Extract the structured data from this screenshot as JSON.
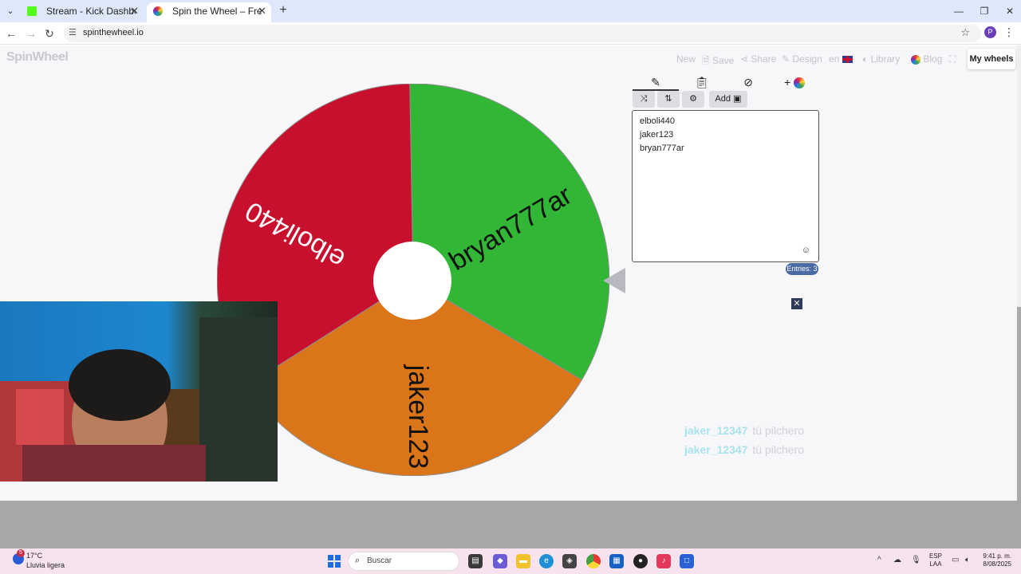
{
  "browser": {
    "tabs": [
      {
        "title": "Stream - Kick Dashboard",
        "active": false
      },
      {
        "title": "Spin the Wheel – Free and easy",
        "active": true
      }
    ],
    "url": "spinthewheel.io",
    "profile_initial": "P"
  },
  "app": {
    "logo": "SpinWheel",
    "nav": {
      "new": "New",
      "save": "Save",
      "share": "Share",
      "design": "Design",
      "lang": "en",
      "library": "Library",
      "blog": "Blog",
      "my_wheels": "My wheels"
    },
    "wheel": {
      "segments": [
        {
          "label": "elboli440",
          "color": "#c8102e"
        },
        {
          "label": "bryan777ar",
          "color": "#31b636"
        },
        {
          "label": "jaker123",
          "color": "#db7519"
        }
      ]
    },
    "panel": {
      "add_label": "Add",
      "entries": [
        "elboli440",
        "jaker123",
        "bryan777ar"
      ],
      "entries_count": "Entries: 3"
    },
    "chat": [
      {
        "user": "jaker_12347",
        "message": "tú pilchero"
      },
      {
        "user": "jaker_12347",
        "message": "tú pilchero"
      }
    ]
  },
  "taskbar": {
    "weather_badge": "5",
    "temperature": "17°C",
    "condition": "Lluvia ligera",
    "search_placeholder": "Buscar",
    "lang_line1": "ESP",
    "lang_line2": "LAA",
    "time": "9:41 p. m.",
    "date": "8/08/2025"
  }
}
